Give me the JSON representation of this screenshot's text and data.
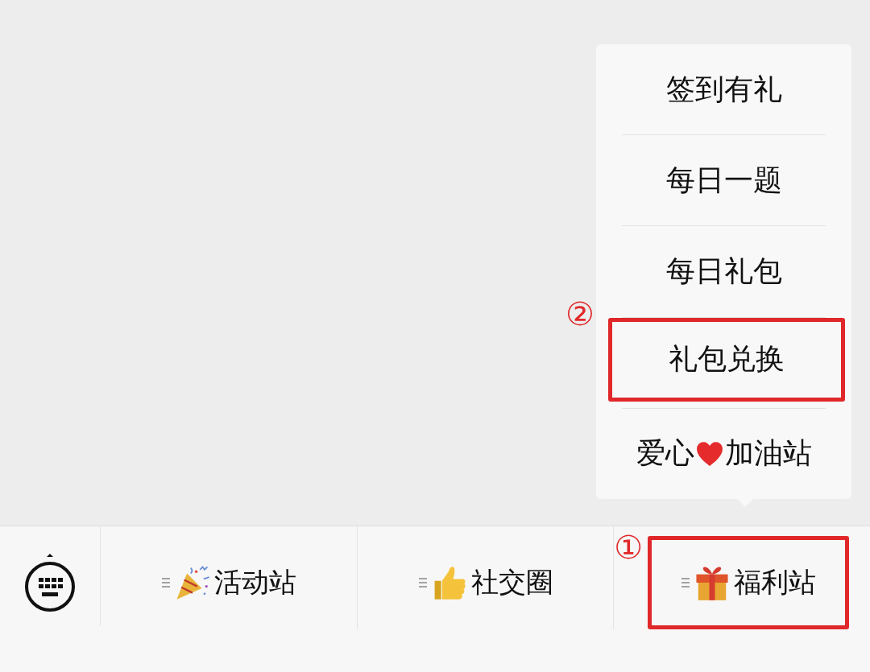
{
  "menu": {
    "items": [
      {
        "kind": "text",
        "label": "签到有礼",
        "annotated": false
      },
      {
        "kind": "text",
        "label": "每日一题",
        "annotated": false
      },
      {
        "kind": "text",
        "label": "每日礼包",
        "annotated": false
      },
      {
        "kind": "text",
        "label": "礼包兑换",
        "annotated": true,
        "annotation": "②"
      },
      {
        "kind": "heart",
        "label_before": "爱心",
        "label_after": "加油站",
        "annotated": false
      }
    ]
  },
  "tabs": [
    {
      "kind": "party",
      "label": "活动站",
      "annotated": false
    },
    {
      "kind": "thumb",
      "label": "社交圈",
      "annotated": false
    },
    {
      "kind": "gift",
      "label": "福利站",
      "annotated": true,
      "annotation": "①"
    }
  ]
}
